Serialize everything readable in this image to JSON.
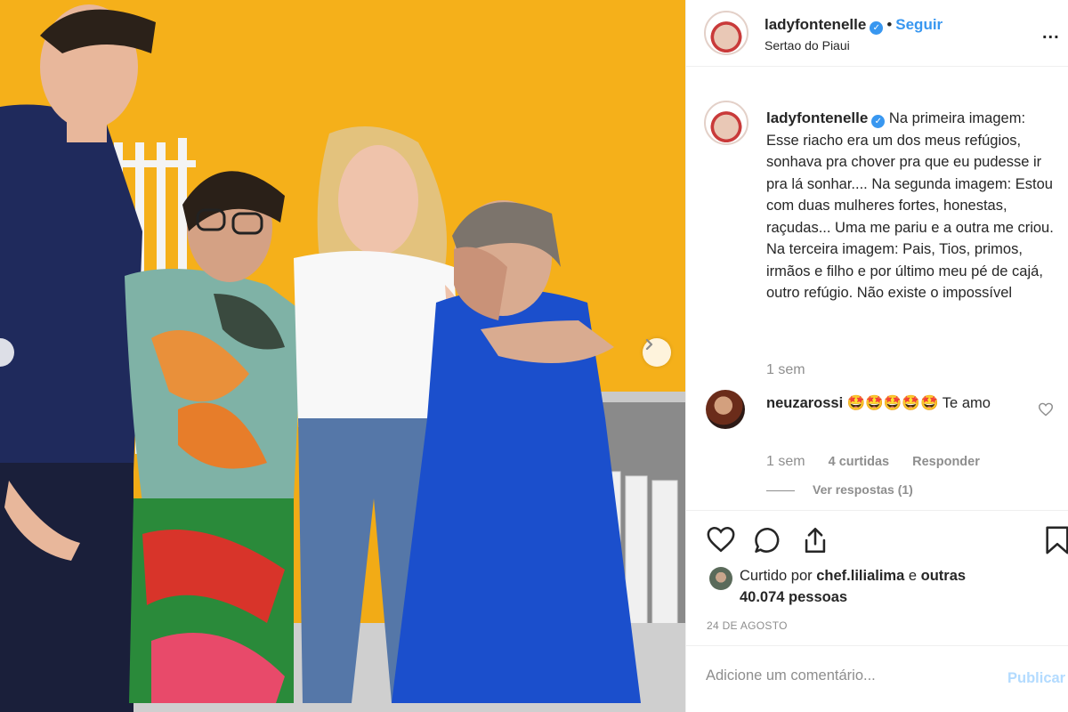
{
  "post": {
    "username": "ladyfontenelle",
    "verified_badge": "✓",
    "separator": "•",
    "follow_label": "Seguir",
    "location": "Sertao do Piaui",
    "more_label": "...",
    "caption": "Na primeira imagem: Esse riacho era um dos meus refúgios, sonhava pra chover pra que eu pudesse ir pra lá sonhar.... Na segunda imagem: Estou com duas mulheres fortes, honestas, raçudas... Uma me pariu e a outra me criou. Na terceira imagem: Pais, Tios, primos, irmãos e filho e por último meu pé de cajá, outro refúgio. Não existe o impossível",
    "caption_time": "1 sem"
  },
  "comments": [
    {
      "username": "neuzarossi",
      "text": "🤩🤩🤩🤩🤩 Te amo",
      "time": "1 sem",
      "likes": "4 curtidas",
      "reply_label": "Responder",
      "view_replies": "Ver respostas (1)"
    }
  ],
  "likes": {
    "prefix": "Curtido por ",
    "first_user": "chef.lilialima",
    "middle": " e ",
    "others": "outras 40.074 pessoas"
  },
  "date": "24 DE AGOSTO",
  "comment_box": {
    "placeholder": "Adicione um comentário...",
    "publish_label": "Publicar"
  },
  "colors": {
    "accent": "#3897f0",
    "publish_disabled": "#b3dbff",
    "muted": "#8e8e8e",
    "wall": "#f2ab16"
  },
  "icons": [
    "heart-icon",
    "comment-icon",
    "share-icon",
    "bookmark-icon",
    "chevron-right-icon",
    "verified-icon"
  ]
}
